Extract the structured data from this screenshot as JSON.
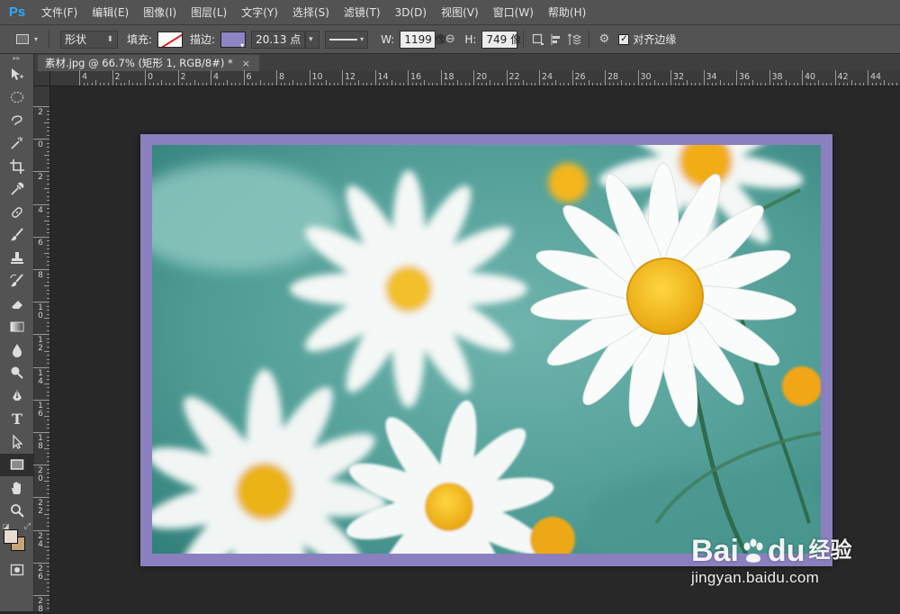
{
  "app": {
    "logo": "Ps"
  },
  "menu": [
    "文件(F)",
    "编辑(E)",
    "图像(I)",
    "图层(L)",
    "文字(Y)",
    "选择(S)",
    "滤镜(T)",
    "3D(D)",
    "视图(V)",
    "窗口(W)",
    "帮助(H)"
  ],
  "options": {
    "mode": "形状",
    "fill_label": "填充:",
    "stroke_label": "描边:",
    "stroke_width": "20.13 点",
    "w_label": "W:",
    "w_value": "1199 像",
    "h_label": "H:",
    "h_value": "749 像",
    "align_edges_label": "对齐边缘",
    "align_edges_checked": true,
    "stroke_color": "#8e86c4"
  },
  "document_tab": {
    "title": "素材.jpg @ 66.7% (矩形 1, RGB/8#) *",
    "close": "×"
  },
  "ruler": {
    "h_labels": [
      "4",
      "2",
      "0",
      "2",
      "4",
      "6",
      "8",
      "10",
      "12",
      "14",
      "16",
      "18",
      "20",
      "22",
      "24",
      "26",
      "28",
      "30",
      "32",
      "34",
      "36",
      "38",
      "40",
      "42",
      "44"
    ],
    "v_labels": [
      "2",
      "0",
      "2",
      "4",
      "6",
      "8",
      "10",
      "12",
      "14",
      "16",
      "18",
      "20",
      "22",
      "24",
      "26",
      "28"
    ]
  },
  "canvas": {
    "frame_color": "#8b80bf"
  },
  "watermark": {
    "brand_a": "Bai",
    "brand_b": "du",
    "brand_cn": "经验",
    "url": "jingyan.baidu.com"
  },
  "colors": {
    "foreground": "#e8dcd0",
    "background": "#c6a27a"
  }
}
